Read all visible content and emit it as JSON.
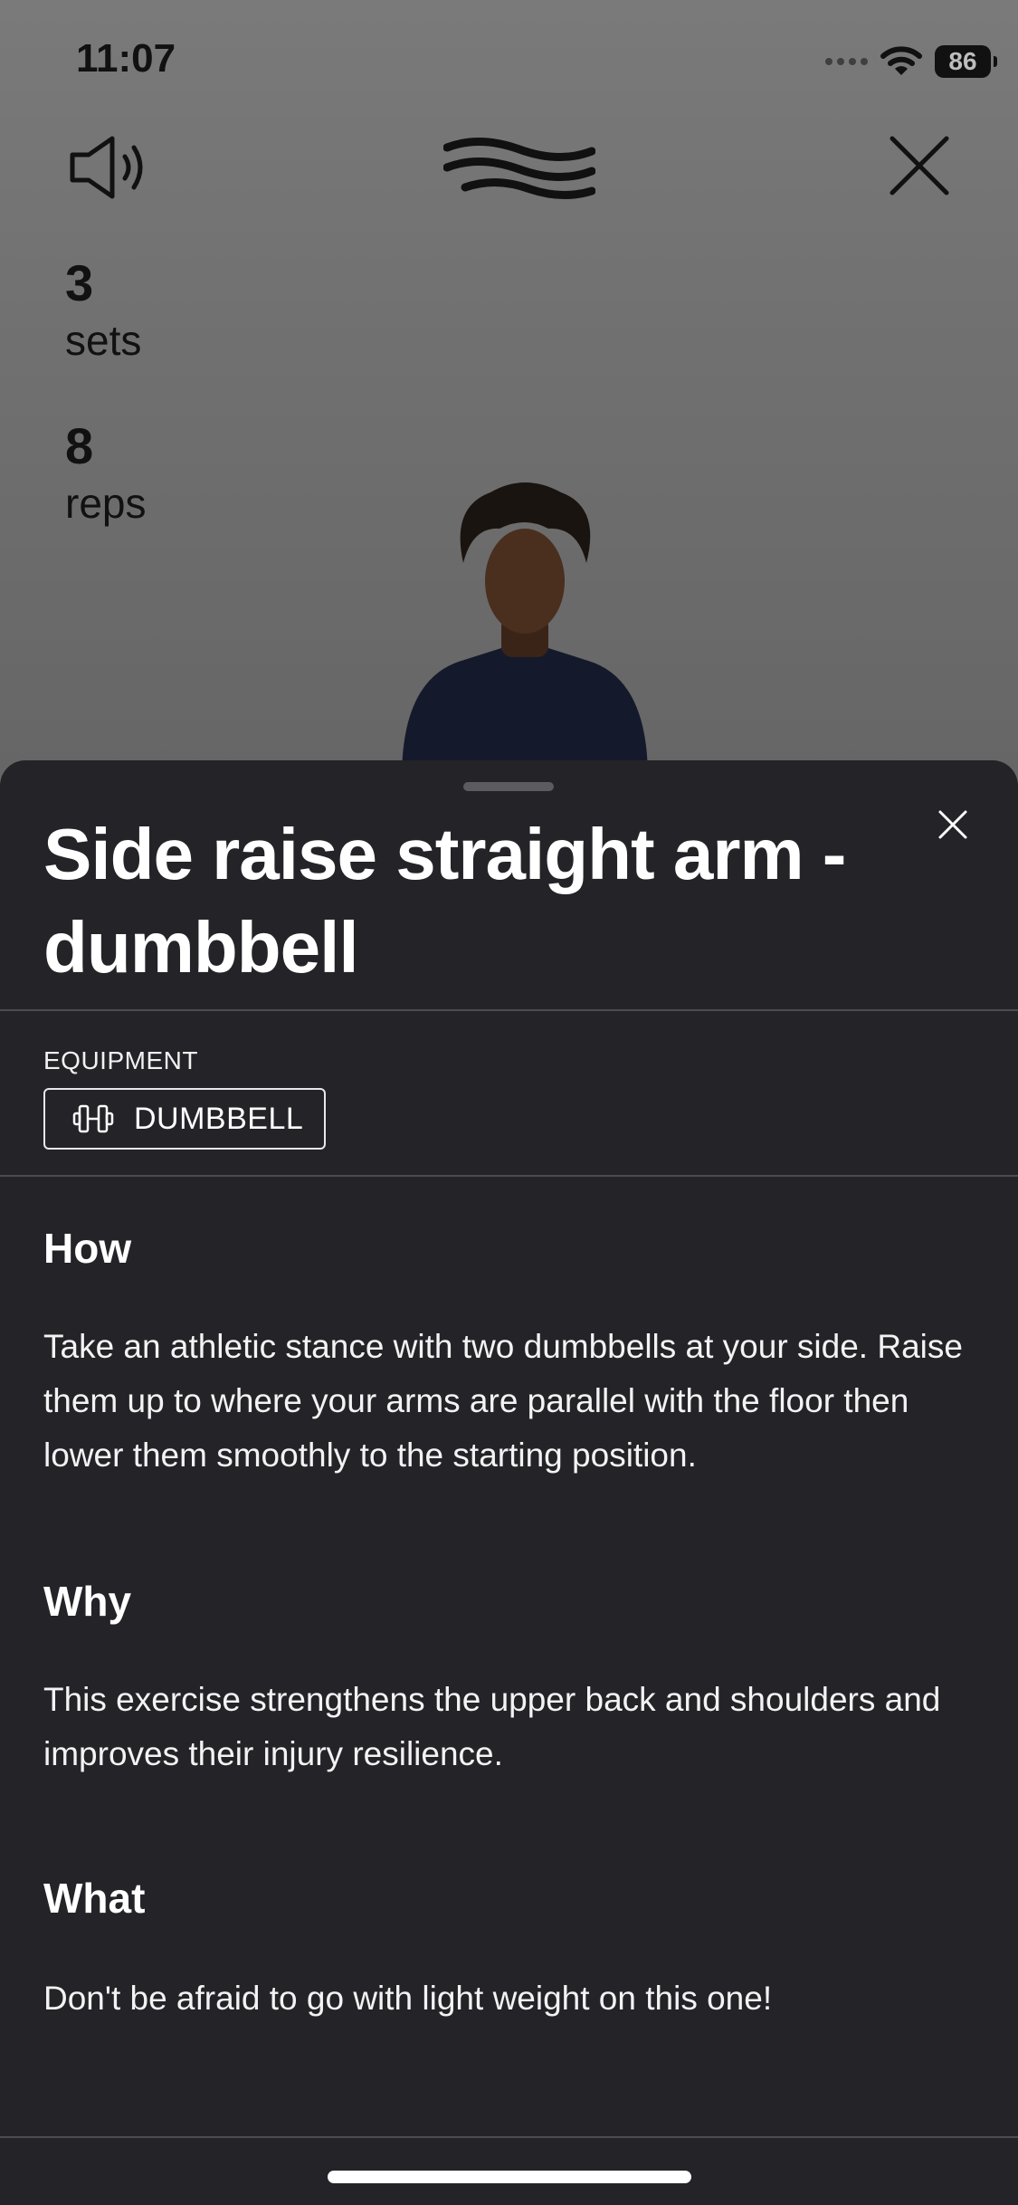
{
  "status_bar": {
    "time": "11:07",
    "battery": "86"
  },
  "workout": {
    "sets": {
      "value": "3",
      "label": "sets"
    },
    "reps": {
      "value": "8",
      "label": "reps"
    }
  },
  "sheet": {
    "title": "Side raise straight arm - dumbbell",
    "equipment_label": "EQUIPMENT",
    "equipment_chip": "DUMBBELL",
    "sections": [
      {
        "heading": "How",
        "body": "Take an athletic stance with two dumbbells at your side. Raise them up to where your arms are parallel with the floor then lower them smoothly to the starting position."
      },
      {
        "heading": "Why",
        "body": "This exercise strengthens the upper back and shoulders and improves their injury resilience."
      },
      {
        "heading": "What",
        "body": "Don't be afraid to go with light weight on this one!"
      }
    ]
  },
  "colors": {
    "sheet_background": "#242328",
    "text": "#ffffff",
    "overlay_background": "#6d6d6d"
  },
  "icons": [
    "speaker-icon",
    "brand-logo-icon",
    "close-icon",
    "dumbbell-icon",
    "wifi-icon",
    "battery-icon"
  ]
}
